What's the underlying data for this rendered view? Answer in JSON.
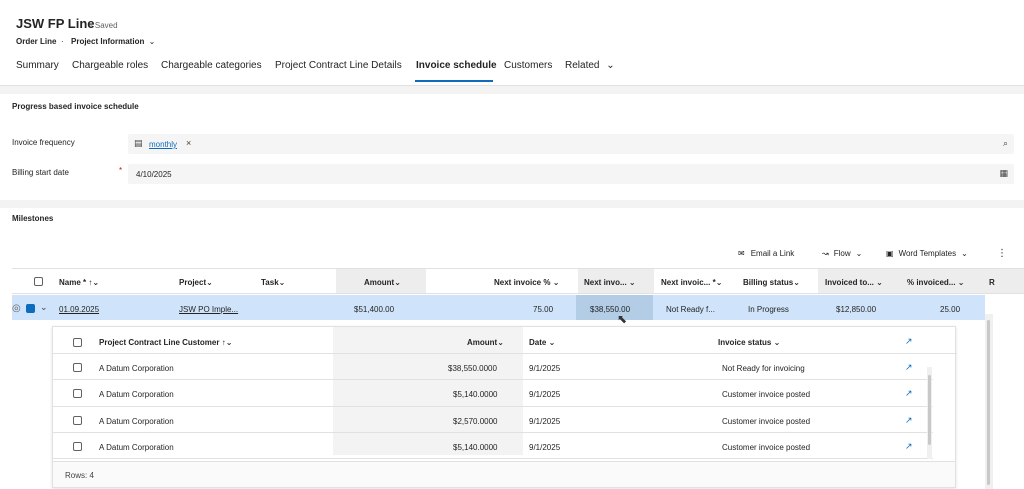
{
  "header": {
    "title": "JSW FP Line",
    "saved": "- Saved",
    "entity": "Order Line",
    "separator": "·",
    "form": "Project Information",
    "tabs": [
      "Summary",
      "Chargeable roles",
      "Chargeable categories",
      "Project Contract Line Details",
      "Invoice schedule",
      "Customers",
      "Related"
    ],
    "active_tab": "Invoice schedule"
  },
  "progress": {
    "title": "Progress based invoice schedule",
    "invoice_frequency_label": "Invoice frequency",
    "invoice_frequency_value": "monthly",
    "billing_start_label": "Billing start date",
    "required_marker": "*",
    "billing_start_value": "4/10/2025"
  },
  "milestones": {
    "title": "Milestones",
    "toolbar": {
      "email": "Email a Link",
      "flow": "Flow",
      "word": "Word Templates"
    },
    "columns": [
      "Name *",
      "Project",
      "Task",
      "Amount",
      "Next invoice %",
      "Next invo...",
      "Next invoic... *",
      "Billing status",
      "Invoiced to...",
      "% invoiced...",
      "R"
    ],
    "row": {
      "name": "01.09.2025",
      "project": "JSW PO Imple...",
      "task": "",
      "amount": "$51,400.00",
      "next_pct": "75.00",
      "next_amt": "$38,550.00",
      "next_status": "Not Ready f...",
      "billing_status": "In Progress",
      "invoiced_to": "$12,850.00",
      "pct_invoiced": "25.00"
    }
  },
  "sub": {
    "columns": [
      "Project Contract Line Customer",
      "Amount",
      "Date",
      "Invoice status"
    ],
    "rows": [
      {
        "customer": "A Datum Corporation",
        "amount": "$38,550.0000",
        "date": "9/1/2025",
        "status": "Not Ready for invoicing"
      },
      {
        "customer": "A Datum Corporation",
        "amount": "$5,140.0000",
        "date": "9/1/2025",
        "status": "Customer invoice posted"
      },
      {
        "customer": "A Datum Corporation",
        "amount": "$2,570.0000",
        "date": "9/1/2025",
        "status": "Customer invoice posted"
      },
      {
        "customer": "A Datum Corporation",
        "amount": "$5,140.0000",
        "date": "9/1/2025",
        "status": "Customer invoice posted"
      }
    ],
    "footer": "Rows: 4"
  },
  "colors": {
    "accent": "#0f6cbd",
    "selected_row": "#cfe4fa",
    "hover_cell": "#b3cde6"
  },
  "icons": [
    "search-icon",
    "calendar-icon",
    "email-icon",
    "flow-icon",
    "word-icon",
    "more-icon",
    "open-record-icon",
    "chevron-down-icon",
    "check-circle-icon",
    "sort-ascending-icon",
    "lookup-record-icon",
    "close-icon"
  ]
}
